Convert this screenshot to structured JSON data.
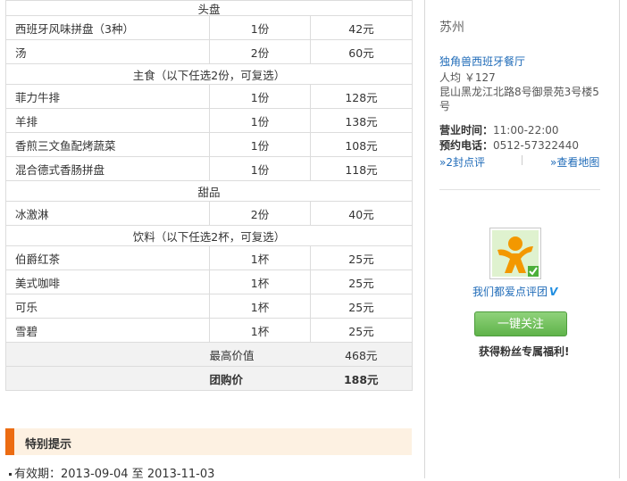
{
  "menu": {
    "rows": [
      {
        "type": "section",
        "label": "头盘"
      },
      {
        "type": "item",
        "name": "西班牙风味拼盘（3种）",
        "qty": "1份",
        "price": "42元"
      },
      {
        "type": "item",
        "name": "汤",
        "qty": "2份",
        "price": "60元"
      },
      {
        "type": "section",
        "label": "主食（以下任选2份，可复选）"
      },
      {
        "type": "item",
        "name": "菲力牛排",
        "qty": "1份",
        "price": "128元"
      },
      {
        "type": "item",
        "name": "羊排",
        "qty": "1份",
        "price": "138元"
      },
      {
        "type": "item",
        "name": "香煎三文鱼配烤蔬菜",
        "qty": "1份",
        "price": "108元"
      },
      {
        "type": "item",
        "name": "混合德式香肠拼盘",
        "qty": "1份",
        "price": "118元"
      },
      {
        "type": "section",
        "label": "甜品"
      },
      {
        "type": "item",
        "name": "冰激淋",
        "qty": "2份",
        "price": "40元"
      },
      {
        "type": "section",
        "label": "饮料（以下任选2杯，可复选）"
      },
      {
        "type": "item",
        "name": "伯爵红茶",
        "qty": "1杯",
        "price": "25元"
      },
      {
        "type": "item",
        "name": "美式咖啡",
        "qty": "1杯",
        "price": "25元"
      },
      {
        "type": "item",
        "name": "可乐",
        "qty": "1杯",
        "price": "25元"
      },
      {
        "type": "item",
        "name": "雪碧",
        "qty": "1杯",
        "price": "25元"
      }
    ],
    "max_value_label": "最高价值",
    "max_value": "468元",
    "group_price_label": "团购价",
    "group_price": "188元"
  },
  "tips": {
    "title": "特别提示",
    "validity": "有效期：2013-09-04 至 2013-11-03"
  },
  "sidebar": {
    "city": "苏州",
    "shop_name": "独角兽西班牙餐厅",
    "avg_price": "人均 ￥127",
    "address": "昆山黑龙江北路8号御景苑3号楼5号",
    "hours_label": "营业时间：",
    "hours": "11:00-22:00",
    "phone_label": "预约电话：",
    "phone": "0512-57322440",
    "reviews_link": "»2封点评",
    "map_link": "»查看地图",
    "group_name": "我们都爱点评团",
    "follow_button": "一键关注",
    "perk_text": "获得粉丝专属福利!"
  },
  "colors": {
    "accent_orange": "#ec6c12",
    "link_blue": "#1f6bb8",
    "button_green": "#5fb34a"
  }
}
